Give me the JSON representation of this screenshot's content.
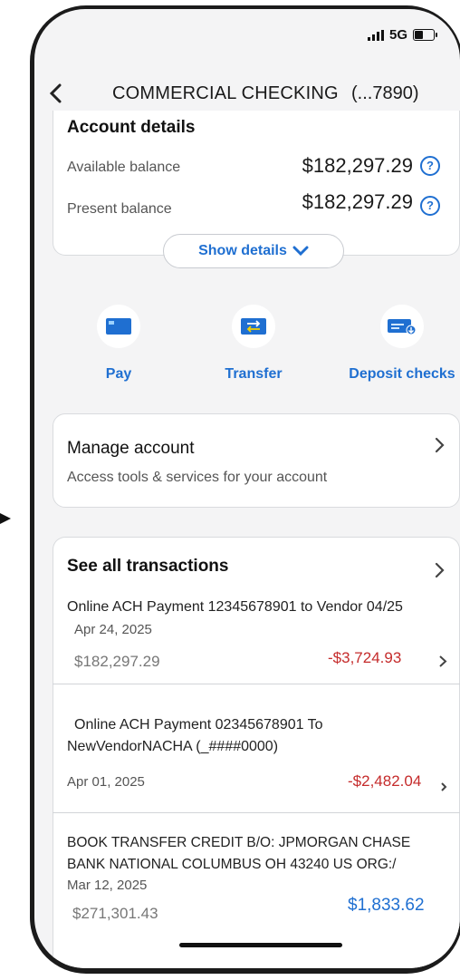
{
  "status": {
    "network": "5G"
  },
  "header": {
    "back_icon": "chevron-left-icon",
    "title": "COMMERCIAL CHECKING",
    "account": "(...7890)"
  },
  "details": {
    "title": "Account details",
    "available_label": "Available balance",
    "available_value": "$182,297.29",
    "present_label": "Present balance",
    "present_value": "$182,297.29",
    "show_details": "Show details"
  },
  "actions": [
    {
      "label": "Pay",
      "icon": "card-icon"
    },
    {
      "label": "Transfer",
      "icon": "transfer-icon"
    },
    {
      "label": "Deposit checks",
      "icon": "check-deposit-icon"
    }
  ],
  "manage": {
    "title": "Manage account",
    "subtitle": "Access tools & services for your account"
  },
  "transactions": {
    "title": "See all transactions",
    "items": [
      {
        "desc": "Online ACH Payment 12345678901 to Vendor 04/25",
        "date": "Apr 24, 2025",
        "balance": "$182,297.29",
        "amount": "-$3,724.93"
      },
      {
        "desc1": "Online ACH Payment 02345678901 To",
        "desc2": "NewVendorNACHA (_####0000)",
        "date": "Apr 01, 2025",
        "amount": "-$2,482.04"
      },
      {
        "desc1": "BOOK TRANSFER CREDIT B/O: JPMORGAN CHASE",
        "desc2": "BANK NATIONAL COLUMBUS OH 43240 US ORG:/",
        "date": "Mar 12, 2025",
        "balance": "$271,301.43",
        "amount": "$1,833.62"
      }
    ]
  },
  "colors": {
    "accent": "#1f6fd1",
    "negative": "#c52b2b",
    "background": "#f4f4f5"
  }
}
